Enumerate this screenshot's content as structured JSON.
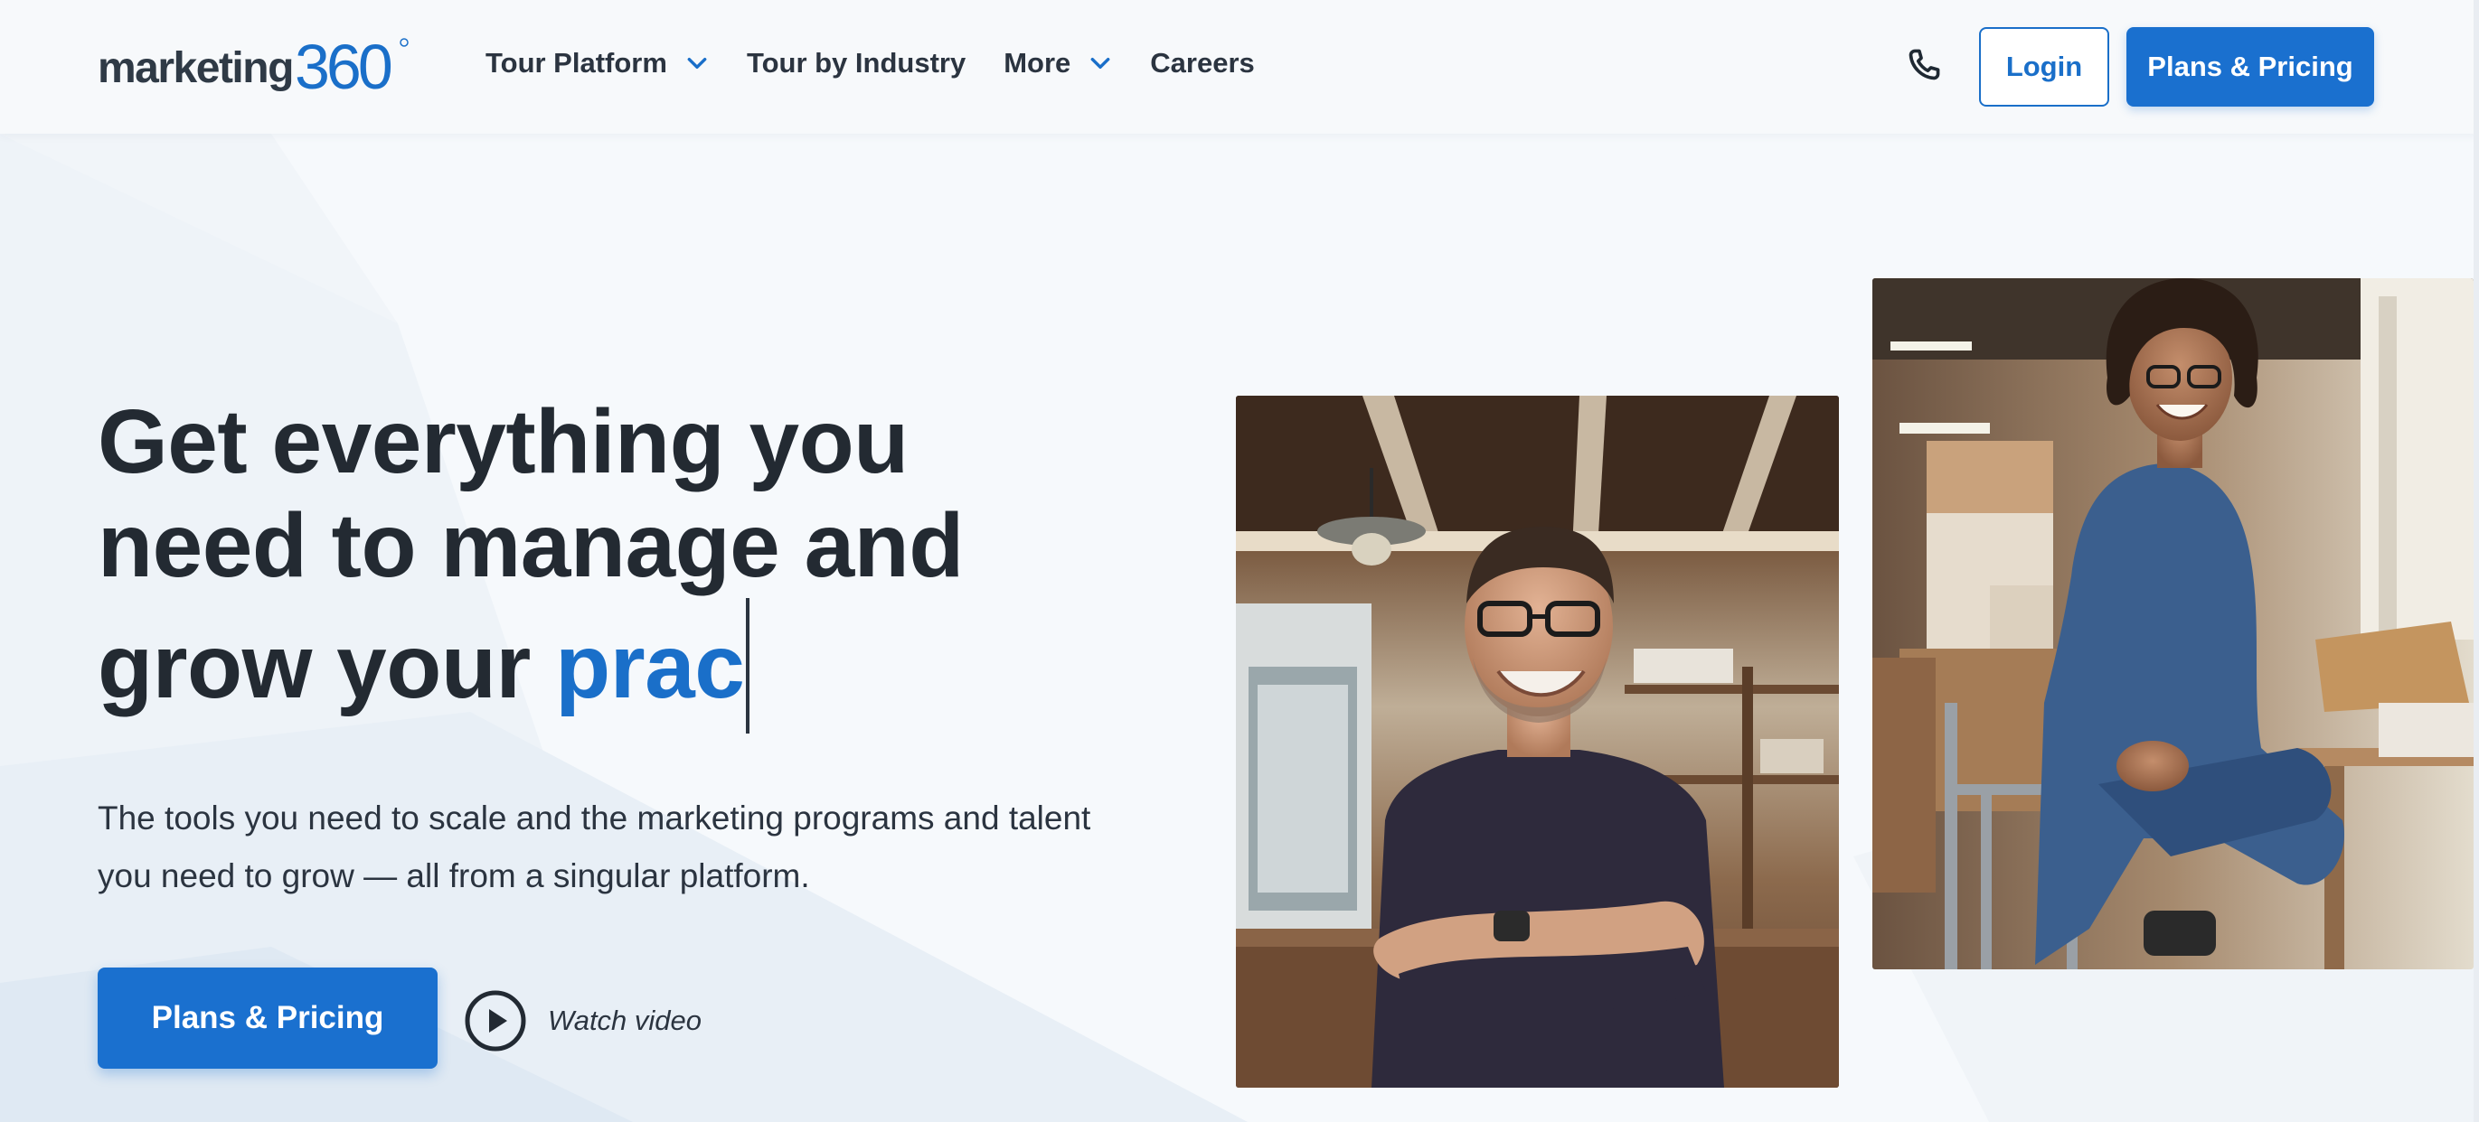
{
  "brand": {
    "logo_text": "marketing360",
    "logo_alt": "Marketing 360 logo",
    "accent_color": "#1a6fc9",
    "text_color": "#232a32"
  },
  "nav": {
    "items": [
      {
        "label": "Tour Platform",
        "has_dropdown": true
      },
      {
        "label": "Tour by Industry",
        "has_dropdown": false
      },
      {
        "label": "More",
        "has_dropdown": true
      },
      {
        "label": "Careers",
        "has_dropdown": false
      }
    ],
    "phone_icon": "phone-icon",
    "login_label": "Login",
    "plans_label": "Plans & Pricing"
  },
  "hero": {
    "title_static": "Get everything you need to manage and grow your",
    "title_typed": "prac",
    "subtitle": "The tools you need to scale and the marketing programs and talent you need to grow — all from a singular platform.",
    "cta_label": "Plans & Pricing",
    "video_label": "Watch video",
    "video_icon": "play-circle-icon"
  },
  "images": {
    "left_photo": "smiling man with glasses, arms crossed, in a cafe",
    "right_photo": "smiling woman in denim sitting on a stool in a warehouse"
  }
}
